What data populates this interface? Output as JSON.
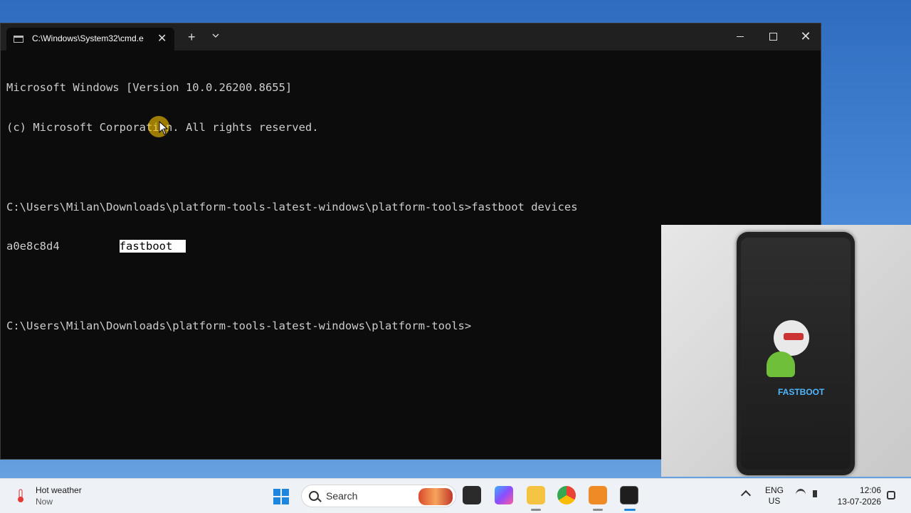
{
  "window": {
    "tab_title": "C:\\Windows\\System32\\cmd.e",
    "new_tab": "+",
    "close_tab": "✕"
  },
  "terminal": {
    "lines": [
      "Microsoft Windows [Version 10.0.26200.8655]",
      "(c) Microsoft Corporation. All rights reserved.",
      "",
      "C:\\Users\\Milan\\Downloads\\platform-tools-latest-windows\\platform-tools>fastboot devices",
      "",
      "",
      "C:\\Users\\Milan\\Downloads\\platform-tools-latest-windows\\platform-tools>"
    ],
    "device_id": "a0e8c8d4",
    "device_state": "fastboot"
  },
  "webcam": {
    "phone_screen_text": "FASTBOOT"
  },
  "taskbar": {
    "weather_title": "Hot weather",
    "weather_sub": "Now",
    "search_label": "Search",
    "lang_1": "ENG",
    "lang_2": "US",
    "time": "12:06",
    "date": "13-07-2026"
  },
  "colors": {
    "terminal_bg": "#0c0c0c",
    "terminal_text": "#cccccc",
    "accent": "#1f86e0"
  }
}
